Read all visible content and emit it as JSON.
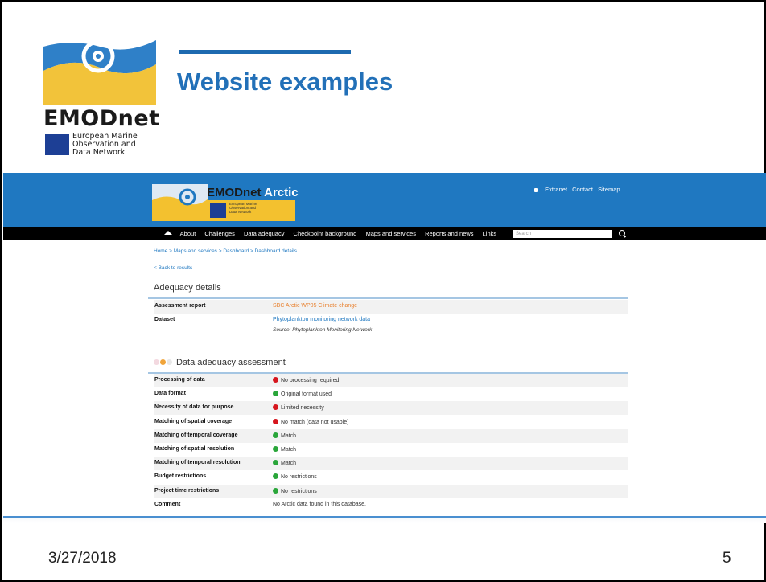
{
  "slide": {
    "title": "Website examples",
    "date": "3/27/2018",
    "page_number": "5"
  },
  "logo": {
    "word": "EMODnet",
    "tagline": "European Marine\nObservation and\nData Network"
  },
  "site": {
    "logo_word_a": "EMODnet",
    "logo_word_b": " Arctic",
    "logo_sub": "European Marine\nObservation and\nData Network",
    "top_links": [
      "Extranet",
      "Contact",
      "Sitemap"
    ],
    "nav": [
      "About",
      "Challenges",
      "Data adequacy",
      "Checkpoint background",
      "Maps and services",
      "Reports and news",
      "Links"
    ],
    "search_placeholder": "Search",
    "breadcrumb": "Home > Maps and services > Dashboard > Dashboard details",
    "back": "< Back to results",
    "details_title": "Adequacy details",
    "details": [
      {
        "key": "Assessment report",
        "value": "SBC Arctic WP05 Climate change"
      },
      {
        "key": "Dataset",
        "value": "Phytoplankton monitoring network data"
      }
    ],
    "dataset_source": "Source: Phytoplankton Monitoring Network",
    "assessment_title": "Data adequacy assessment",
    "assessment": [
      {
        "key": "Processing of data",
        "value": "No processing required",
        "status": "red"
      },
      {
        "key": "Data format",
        "value": "Original format used",
        "status": "green"
      },
      {
        "key": "Necessity of data for purpose",
        "value": "Limited necessity",
        "status": "red"
      },
      {
        "key": "Matching of spatial coverage",
        "value": "No match (data not usable)",
        "status": "red"
      },
      {
        "key": "Matching of temporal coverage",
        "value": "Match",
        "status": "green"
      },
      {
        "key": "Matching of spatial resolution",
        "value": "Match",
        "status": "green"
      },
      {
        "key": "Matching of temporal resolution",
        "value": "Match",
        "status": "green"
      },
      {
        "key": "Budget restrictions",
        "value": "No restrictions",
        "status": "green"
      },
      {
        "key": "Project time restrictions",
        "value": "No restrictions",
        "status": "green"
      },
      {
        "key": "Comment",
        "value": "No Arctic data found in this database.",
        "status": "none"
      }
    ]
  },
  "colors": {
    "brand_blue": "#1f78c1",
    "title_blue": "#2270b8",
    "accent_orange": "#e8812f",
    "status_red": "#d6161e",
    "status_green": "#2aa63a"
  }
}
